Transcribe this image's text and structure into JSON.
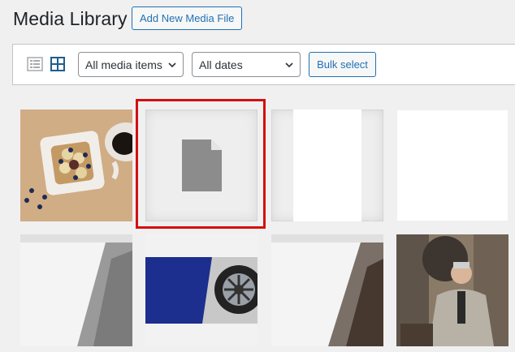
{
  "header": {
    "title": "Media Library",
    "add_new_label": "Add New Media File"
  },
  "toolbar": {
    "view_modes": [
      {
        "name": "list",
        "icon": "list-view-icon",
        "active": false
      },
      {
        "name": "grid",
        "icon": "grid-view-icon",
        "active": true
      }
    ],
    "filter_type": {
      "selected": "All media items"
    },
    "filter_date": {
      "selected": "All dates"
    },
    "bulk_select_label": "Bulk select"
  },
  "media_items": [
    {
      "kind": "image",
      "subject": "waffles with berries and coffee"
    },
    {
      "kind": "document",
      "icon": "document-icon",
      "selected_highlight": true
    },
    {
      "kind": "image",
      "subject": "blank white image"
    },
    {
      "kind": "image",
      "subject": "blank white image"
    },
    {
      "kind": "image",
      "subject": "grey diagonal graphic"
    },
    {
      "kind": "image",
      "subject": "blue banner with car wheel"
    },
    {
      "kind": "image",
      "subject": "grey diagonal graphic"
    },
    {
      "kind": "image",
      "subject": "mechanic in workshop"
    }
  ],
  "colors": {
    "accent": "#2271b1",
    "highlight": "#d30f0f",
    "background": "#f0f0f1"
  }
}
